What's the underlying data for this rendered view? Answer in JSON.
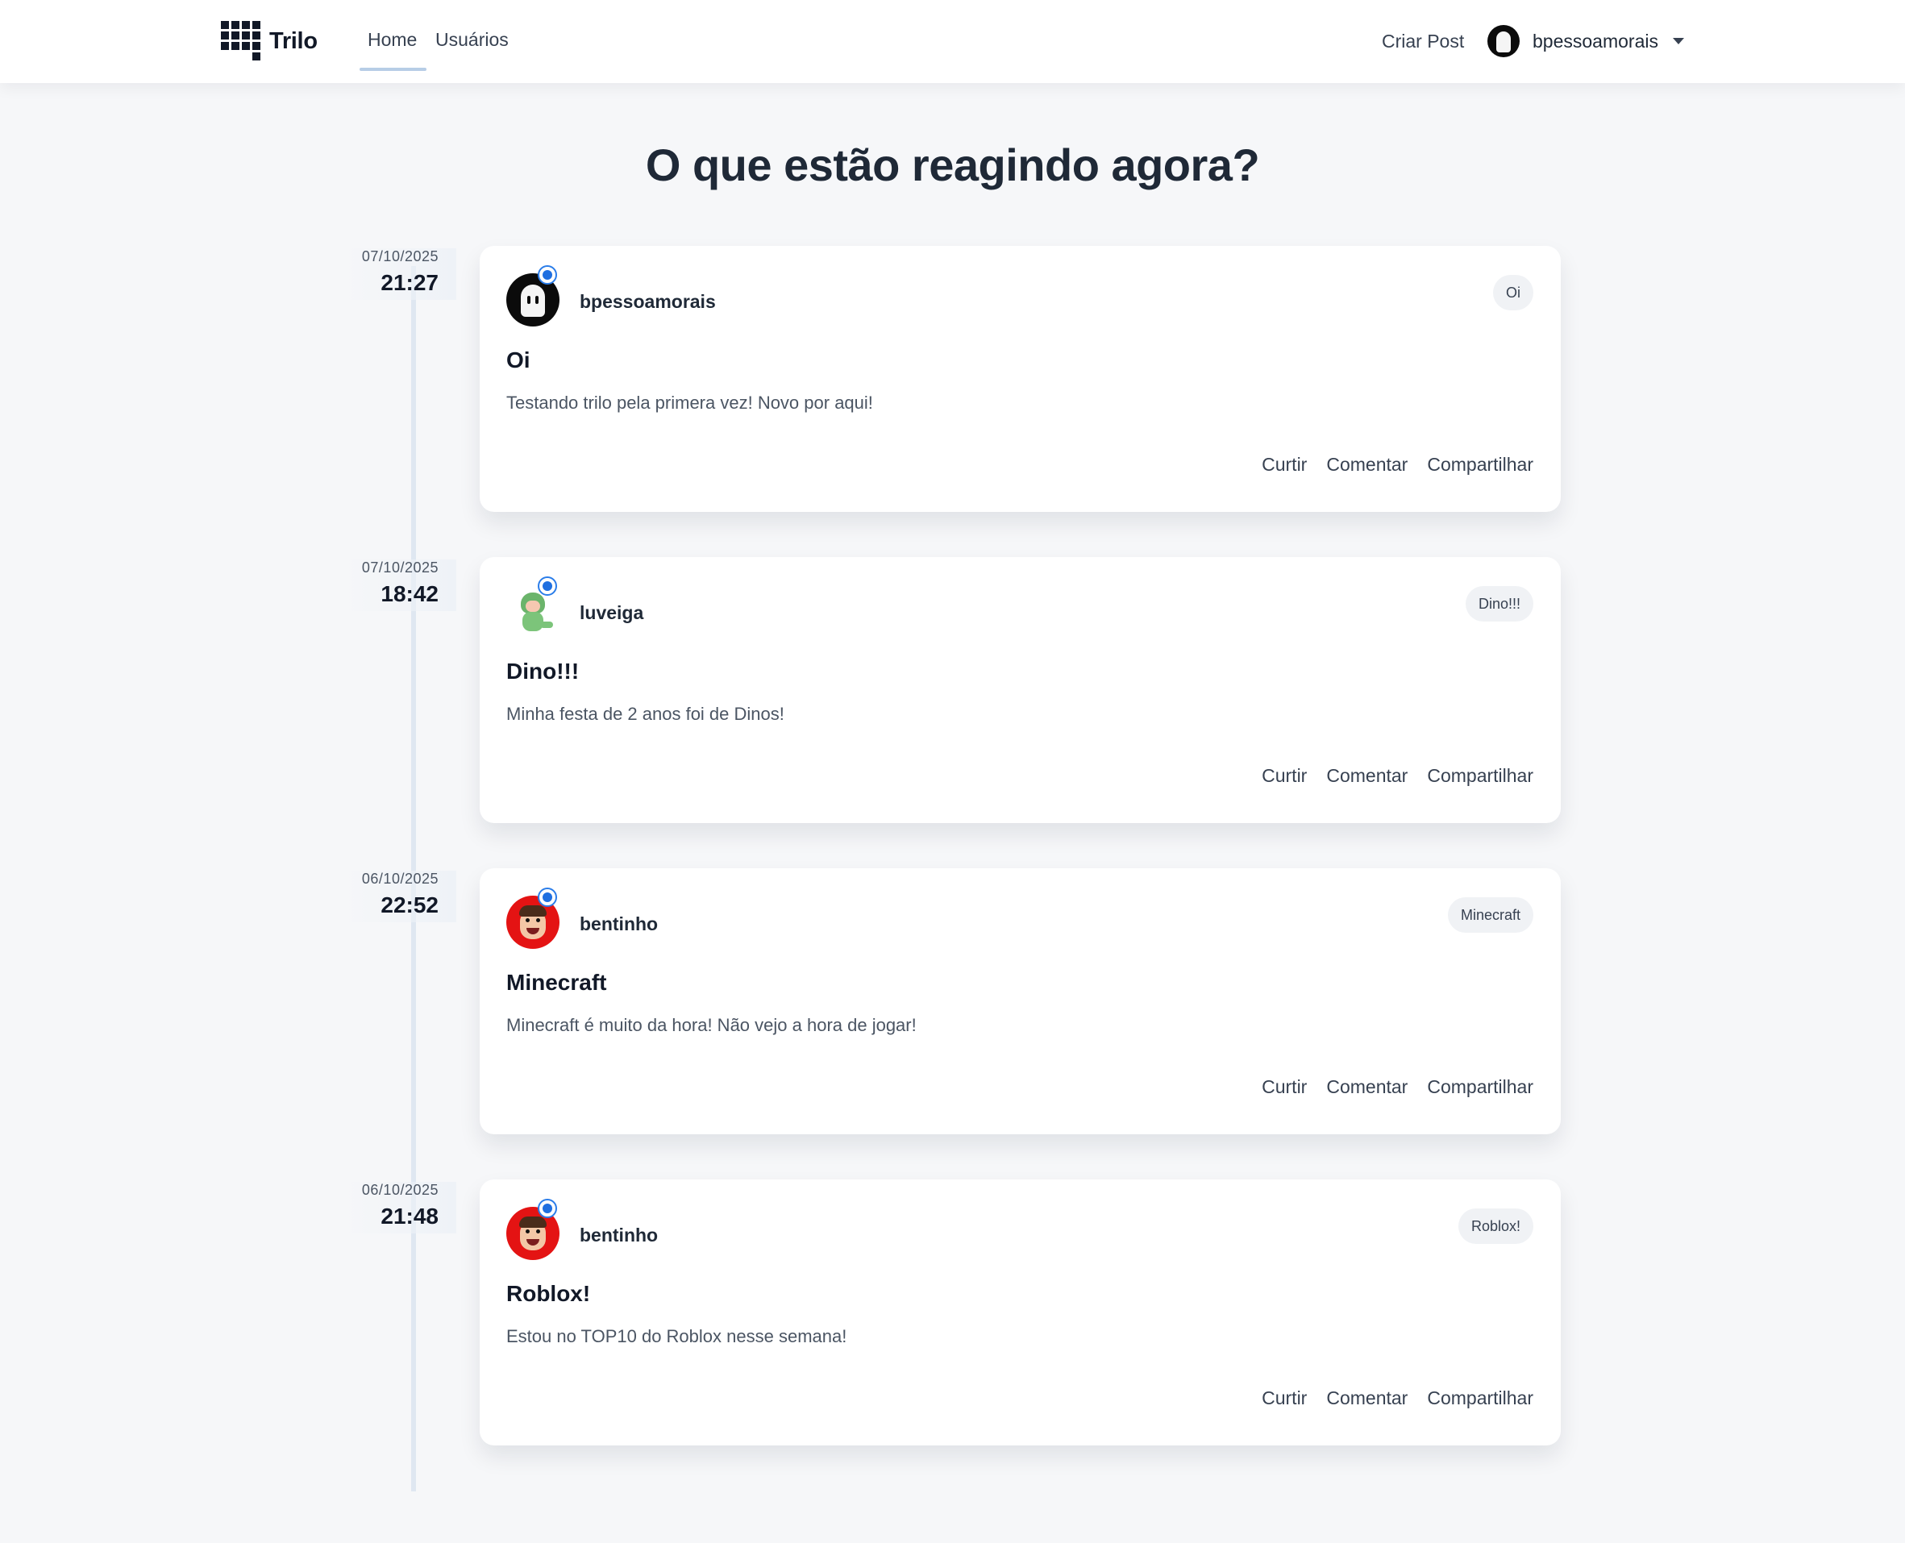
{
  "nav": {
    "brand": "Trilo",
    "links": [
      {
        "label": "Home",
        "active": true
      },
      {
        "label": "Usuários",
        "active": false
      }
    ],
    "create_post": "Criar Post",
    "user": {
      "name": "bpessoamorais",
      "avatar_icon": "ghost-avatar-icon"
    }
  },
  "page": {
    "title": "O que estão reagindo agora?"
  },
  "colors": {
    "accent": "#1f6fe0",
    "background": "#f6f7f9",
    "card": "#ffffff",
    "underline": "#b7cde6"
  },
  "posts": [
    {
      "date": "07/10/2025",
      "time": "21:27",
      "author": "bpessoamorais",
      "avatar": "ghost-avatar-icon",
      "tag": "Oi",
      "title": "Oi",
      "body": "Testando trilo pela primera vez! Novo por aqui!",
      "actions": {
        "like": "Curtir",
        "comment": "Comentar",
        "share": "Compartilhar"
      }
    },
    {
      "date": "07/10/2025",
      "time": "18:42",
      "author": "luveiga",
      "avatar": "dino-avatar-icon",
      "tag": "Dino!!!",
      "title": "Dino!!!",
      "body": "Minha festa de 2 anos foi de Dinos!",
      "actions": {
        "like": "Curtir",
        "comment": "Comentar",
        "share": "Compartilhar"
      }
    },
    {
      "date": "06/10/2025",
      "time": "22:52",
      "author": "bentinho",
      "avatar": "cartoon-face-avatar-icon",
      "tag": "Minecraft",
      "title": "Minecraft",
      "body": "Minecraft é muito da hora! Não vejo a hora de jogar!",
      "actions": {
        "like": "Curtir",
        "comment": "Comentar",
        "share": "Compartilhar"
      }
    },
    {
      "date": "06/10/2025",
      "time": "21:48",
      "author": "bentinho",
      "avatar": "cartoon-face-avatar-icon",
      "tag": "Roblox!",
      "title": "Roblox!",
      "body": "Estou no TOP10 do Roblox nesse semana!",
      "actions": {
        "like": "Curtir",
        "comment": "Comentar",
        "share": "Compartilhar"
      }
    }
  ]
}
